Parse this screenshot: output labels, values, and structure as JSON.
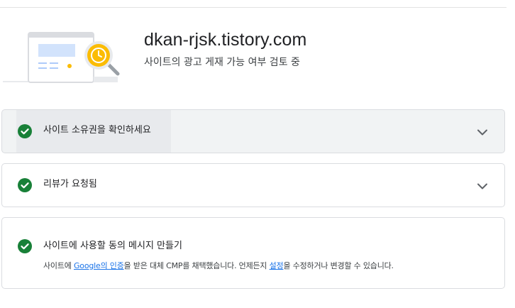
{
  "header": {
    "domain": "dkan-rjsk.tistory.com",
    "status": "사이트의 광고 게재 가능 여부 검토 중"
  },
  "steps": [
    {
      "title": "사이트 소유권을 확인하세요",
      "state": "complete",
      "icon": "check-circle-icon",
      "expander": "chevron-down-icon"
    },
    {
      "title": "리뷰가 요청됨",
      "state": "complete",
      "icon": "check-circle-icon",
      "expander": "chevron-down-icon"
    },
    {
      "title": "사이트에 사용할 동의 메시지 만들기",
      "state": "complete",
      "icon": "check-circle-icon",
      "description": {
        "part1": "사이트에 ",
        "link1": "Google의 인증",
        "part2": "을 받은 대체 CMP를 채택했습니다. 언제든지 ",
        "link2": "설정",
        "part3": "을 수정하거나 변경할 수 있습니다."
      }
    }
  ],
  "colors": {
    "success": "#188038",
    "link": "#1a73e8",
    "accent_yellow": "#fbbc04",
    "border": "#dadce0"
  }
}
